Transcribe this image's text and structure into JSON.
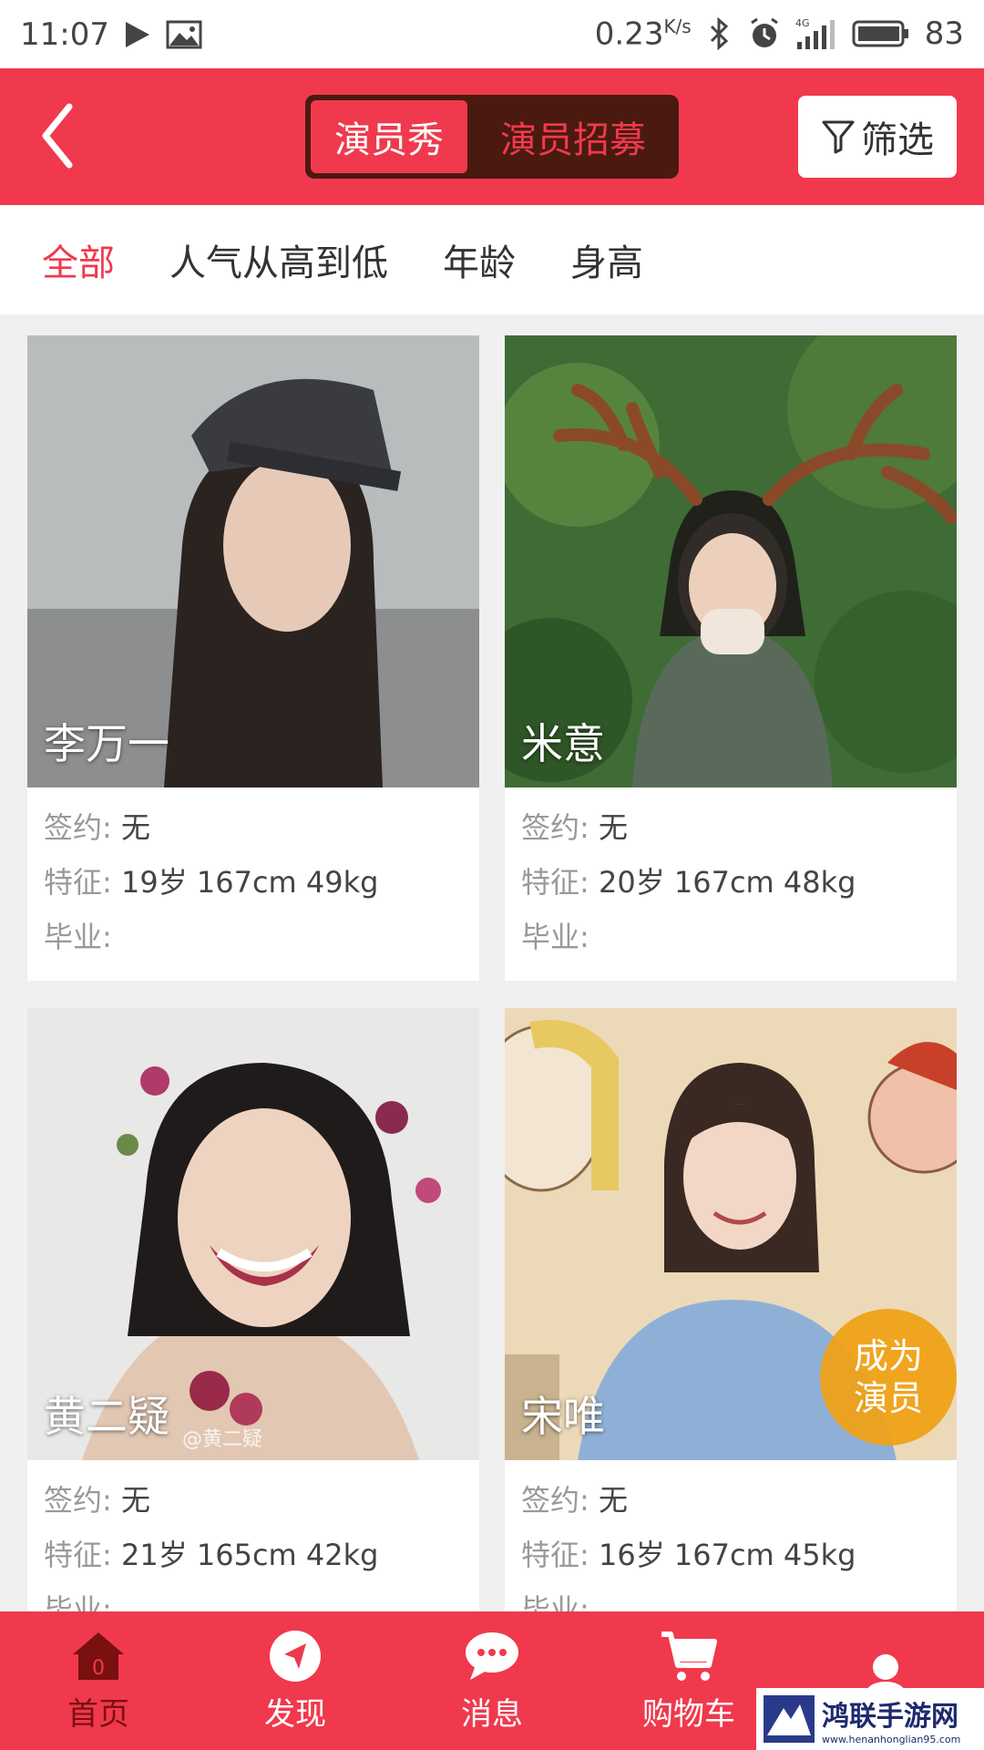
{
  "status_bar": {
    "time": "11:07",
    "speed": "0.23",
    "speed_unit": "K/s",
    "battery": "83"
  },
  "header": {
    "tabs": [
      {
        "label": "演员秀",
        "active": true
      },
      {
        "label": "演员招募",
        "active": false
      }
    ],
    "filter_label": "筛选"
  },
  "sort": {
    "items": [
      "全部",
      "人气从高到低",
      "年龄",
      "身高"
    ],
    "active_index": 0
  },
  "actors": [
    {
      "name": "李万一",
      "contract_label": "签约:",
      "contract": "无",
      "feature_label": "特征:",
      "feature": "19岁  167cm  49kg",
      "grad_label": "毕业:",
      "grad": ""
    },
    {
      "name": "米意",
      "contract_label": "签约:",
      "contract": "无",
      "feature_label": "特征:",
      "feature": "20岁  167cm  48kg",
      "grad_label": "毕业:",
      "grad": ""
    },
    {
      "name": "黄二疑",
      "contract_label": "签约:",
      "contract": "无",
      "feature_label": "特征:",
      "feature": "21岁  165cm  42kg",
      "grad_label": "毕业:",
      "grad": "",
      "watermark": "@黄二疑"
    },
    {
      "name": "宋唯",
      "contract_label": "签约:",
      "contract": "无",
      "feature_label": "特征:",
      "feature": "16岁  167cm  45kg",
      "grad_label": "毕业:",
      "grad": ""
    }
  ],
  "badge": {
    "line1": "成为",
    "line2": "演员"
  },
  "bottom_nav": [
    {
      "label": "首页",
      "icon": "home-icon",
      "badge": "0",
      "active": true
    },
    {
      "label": "发现",
      "icon": "compass-icon"
    },
    {
      "label": "消息",
      "icon": "message-icon"
    },
    {
      "label": "购物车",
      "icon": "cart-icon"
    },
    {
      "label": "",
      "icon": "user-icon"
    }
  ],
  "site_watermark": {
    "title": "鸿联手游网",
    "url": "www.henanhonglian95.com"
  },
  "colors": {
    "brand": "#f0394d",
    "segment_bg": "#4a1a10",
    "badge": "#f0a014"
  }
}
